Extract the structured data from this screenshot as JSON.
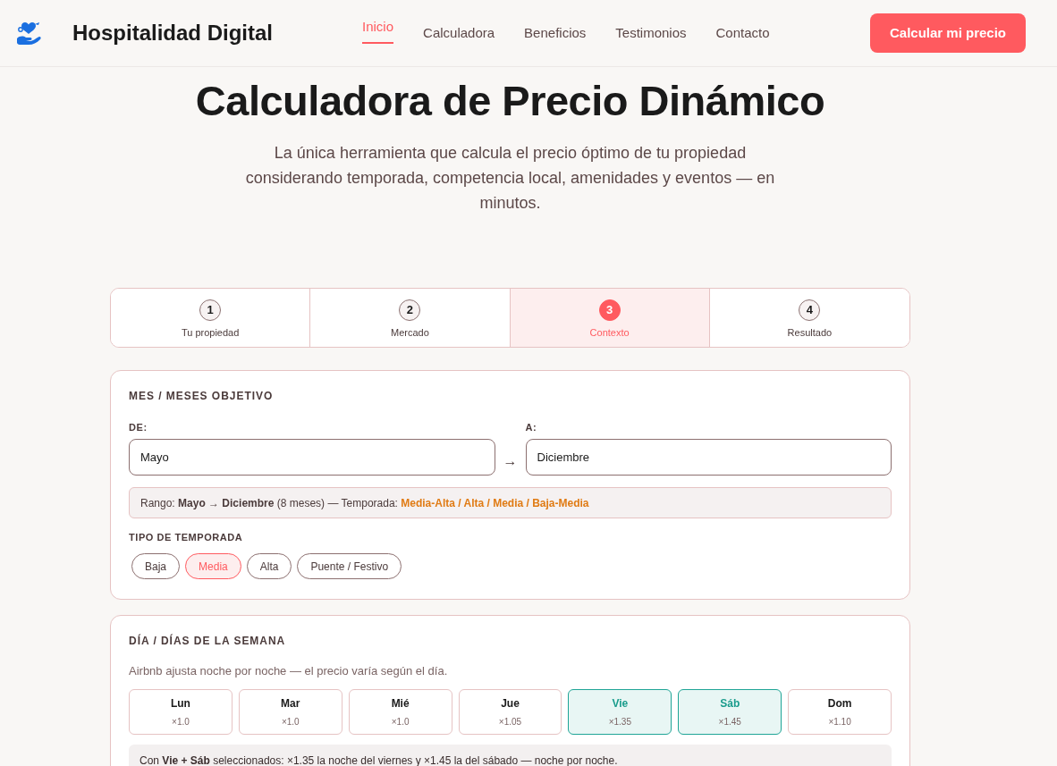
{
  "header": {
    "brand": "Hospitalidad Digital",
    "nav": [
      {
        "label": "Inicio",
        "selected": true
      },
      {
        "label": "Calculadora",
        "selected": false
      },
      {
        "label": "Beneficios",
        "selected": false
      },
      {
        "label": "Testimonios",
        "selected": false
      },
      {
        "label": "Contacto",
        "selected": false
      }
    ],
    "cta": "Calcular mi precio"
  },
  "hero": {
    "title": "Calculadora de Precio Dinámico",
    "subtitle": "La única herramienta que calcula el precio óptimo de tu propiedad considerando temporada, competencia local, amenidades y eventos — en minutos."
  },
  "steps": [
    {
      "number": "1",
      "label": "Tu propiedad",
      "selected": false
    },
    {
      "number": "2",
      "label": "Mercado",
      "selected": false
    },
    {
      "number": "3",
      "label": "Contexto",
      "selected": true
    },
    {
      "number": "4",
      "label": "Resultado",
      "selected": false
    }
  ],
  "months_card": {
    "heading": "MES / MESES OBJETIVO",
    "from": {
      "label": "DE:",
      "value": "Mayo"
    },
    "arrow": "→",
    "to": {
      "label": "A:",
      "value": "Diciembre"
    },
    "summary": {
      "text": "Rango: **Mayo → Diciembre** (8 meses) — Temporada:",
      "highlight": "Media-Alta / Alta / Media / Baja-Media"
    },
    "season_heading": "TIPO DE TEMPORADA",
    "seasons": [
      {
        "label": "Baja",
        "selected": false
      },
      {
        "label": "Media",
        "selected": true
      },
      {
        "label": "Alta",
        "selected": false
      },
      {
        "label": "Puente / Festivo",
        "selected": false
      }
    ]
  },
  "days_card": {
    "heading": "DÍA / DÍAS DE LA SEMANA",
    "description": "Airbnb ajusta noche por noche — el precio varía según el día.",
    "days": [
      {
        "label": "Lun",
        "factor": "×1.0",
        "selected": false
      },
      {
        "label": "Mar",
        "factor": "×1.0",
        "selected": false
      },
      {
        "label": "Mié",
        "factor": "×1.0",
        "selected": false
      },
      {
        "label": "Jue",
        "factor": "×1.05",
        "selected": false
      },
      {
        "label": "Vie",
        "factor": "×1.35",
        "selected": true
      },
      {
        "label": "Sáb",
        "factor": "×1.45",
        "selected": true
      },
      {
        "label": "Dom",
        "factor": "×1.10",
        "selected": false
      }
    ],
    "note": "Con **Vie + Sáb** seleccionados: ×1.35 la noche del viernes y ×1.45 la del sábado — noche por noche."
  }
}
